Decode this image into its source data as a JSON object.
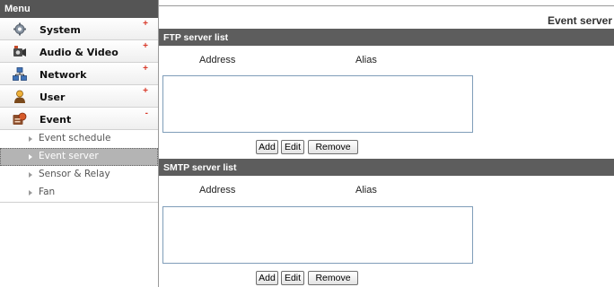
{
  "sidebar": {
    "header": "Menu",
    "items": [
      {
        "label": "System",
        "sign": "+",
        "icon": "gear-icon"
      },
      {
        "label": "Audio & Video",
        "sign": "+",
        "icon": "camera-icon"
      },
      {
        "label": "Network",
        "sign": "+",
        "icon": "network-icon"
      },
      {
        "label": "User",
        "sign": "+",
        "icon": "user-icon"
      },
      {
        "label": "Event",
        "sign": "-",
        "icon": "event-icon"
      }
    ],
    "event_submenu": [
      "Event schedule",
      "Event server",
      "Sensor & Relay",
      "Fan"
    ],
    "active_submenu": "Event server"
  },
  "main": {
    "title": "Event server",
    "ftp": {
      "header": "FTP server list",
      "col_address": "Address",
      "col_alias": "Alias",
      "buttons": {
        "add": "Add",
        "edit": "Edit",
        "remove": "Remove"
      }
    },
    "smtp": {
      "header": "SMTP server list",
      "col_address": "Address",
      "col_alias": "Alias",
      "buttons": {
        "add": "Add",
        "edit": "Edit",
        "remove": "Remove"
      }
    }
  },
  "colors": {
    "header_bg": "#5d5d5d",
    "active_item_bg": "#b4b4b4",
    "expand_sign": "#d83a2a",
    "listbox_border": "#7f9db9"
  }
}
